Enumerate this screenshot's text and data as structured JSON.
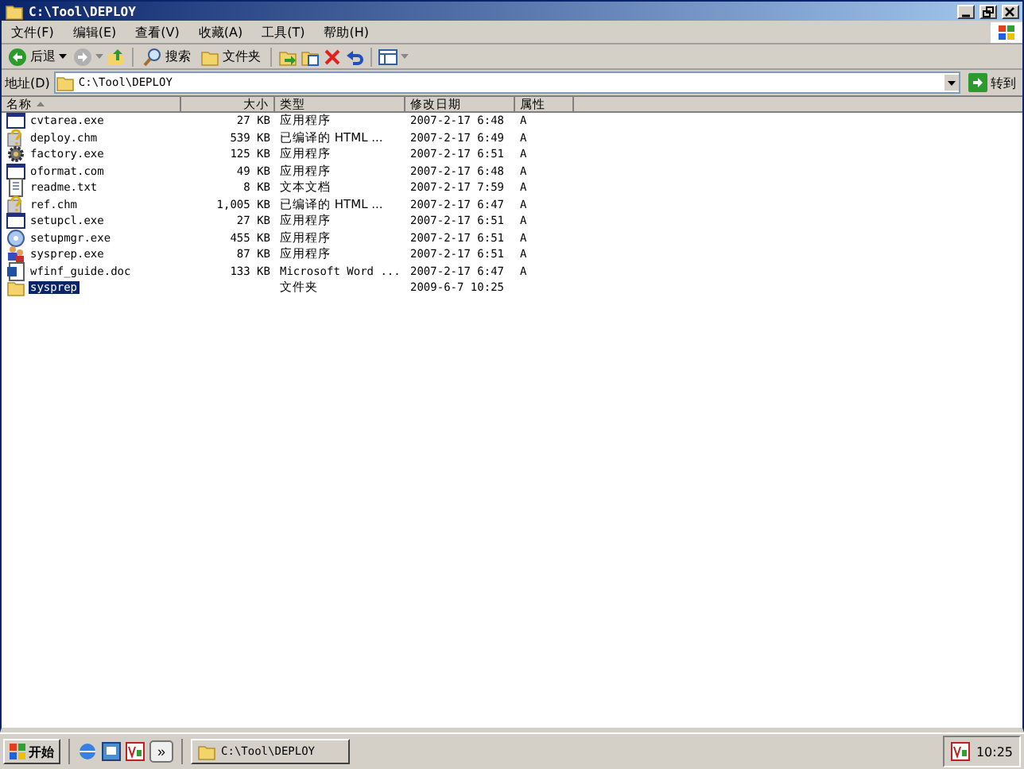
{
  "window": {
    "title": "C:\\Tool\\DEPLOY"
  },
  "menu": [
    "文件(F)",
    "编辑(E)",
    "查看(V)",
    "收藏(A)",
    "工具(T)",
    "帮助(H)"
  ],
  "toolbar": [
    {
      "kind": "back",
      "label": "后退"
    },
    {
      "kind": "forward"
    },
    {
      "kind": "up"
    },
    {
      "kind": "search",
      "label": "搜索"
    },
    {
      "kind": "folders",
      "label": "文件夹"
    },
    {
      "kind": "move"
    },
    {
      "kind": "copy"
    },
    {
      "kind": "delete"
    },
    {
      "kind": "undo"
    },
    {
      "kind": "views"
    }
  ],
  "address": {
    "label": "地址(D)",
    "value": "C:\\Tool\\DEPLOY",
    "go": "转到"
  },
  "table": {
    "columns": [
      {
        "label": "名称",
        "sorted": true
      },
      {
        "label": "大小",
        "sorted": false
      },
      {
        "label": "类型",
        "sorted": false
      },
      {
        "label": "修改日期",
        "sorted": false
      },
      {
        "label": "属性",
        "sorted": false
      }
    ],
    "rows": [
      {
        "kind": "app",
        "name": "cvtarea.exe",
        "size": "27 KB",
        "type": "应用程序",
        "modified": "2007-2-17 6:48",
        "attributes": "A",
        "selected": false
      },
      {
        "kind": "help",
        "name": "deploy.chm",
        "size": "539 KB",
        "type": "已编译的 HTML ...",
        "modified": "2007-2-17 6:49",
        "attributes": "A",
        "selected": false
      },
      {
        "kind": "gear",
        "name": "factory.exe",
        "size": "125 KB",
        "type": "应用程序",
        "modified": "2007-2-17 6:51",
        "attributes": "A",
        "selected": false
      },
      {
        "kind": "app",
        "name": "oformat.com",
        "size": "49 KB",
        "type": "应用程序",
        "modified": "2007-2-17 6:48",
        "attributes": "A",
        "selected": false
      },
      {
        "kind": "text",
        "name": "readme.txt",
        "size": "8 KB",
        "type": "文本文档",
        "modified": "2007-2-17 7:59",
        "attributes": "A",
        "selected": false
      },
      {
        "kind": "help",
        "name": "ref.chm",
        "size": "1,005 KB",
        "type": "已编译的 HTML ...",
        "modified": "2007-2-17 6:47",
        "attributes": "A",
        "selected": false
      },
      {
        "kind": "app",
        "name": "setupcl.exe",
        "size": "27 KB",
        "type": "应用程序",
        "modified": "2007-2-17 6:51",
        "attributes": "A",
        "selected": false
      },
      {
        "kind": "disc",
        "name": "setupmgr.exe",
        "size": "455 KB",
        "type": "应用程序",
        "modified": "2007-2-17 6:51",
        "attributes": "A",
        "selected": false
      },
      {
        "kind": "people",
        "name": "sysprep.exe",
        "size": "87 KB",
        "type": "应用程序",
        "modified": "2007-2-17 6:51",
        "attributes": "A",
        "selected": false
      },
      {
        "kind": "word",
        "name": "wfinf_guide.doc",
        "size": "133 KB",
        "type": "Microsoft Word ...",
        "modified": "2007-2-17 6:47",
        "attributes": "A",
        "selected": false
      },
      {
        "kind": "folder",
        "name": "sysprep",
        "type": "文件夹",
        "modified": "2009-6-7 10:25",
        "selected": true
      }
    ]
  },
  "taskbar": {
    "start": "开始",
    "chevron": "»",
    "tasks": [
      {
        "label": "C:\\Tool\\DEPLOY",
        "selected": false
      }
    ],
    "clock": "10:25"
  }
}
